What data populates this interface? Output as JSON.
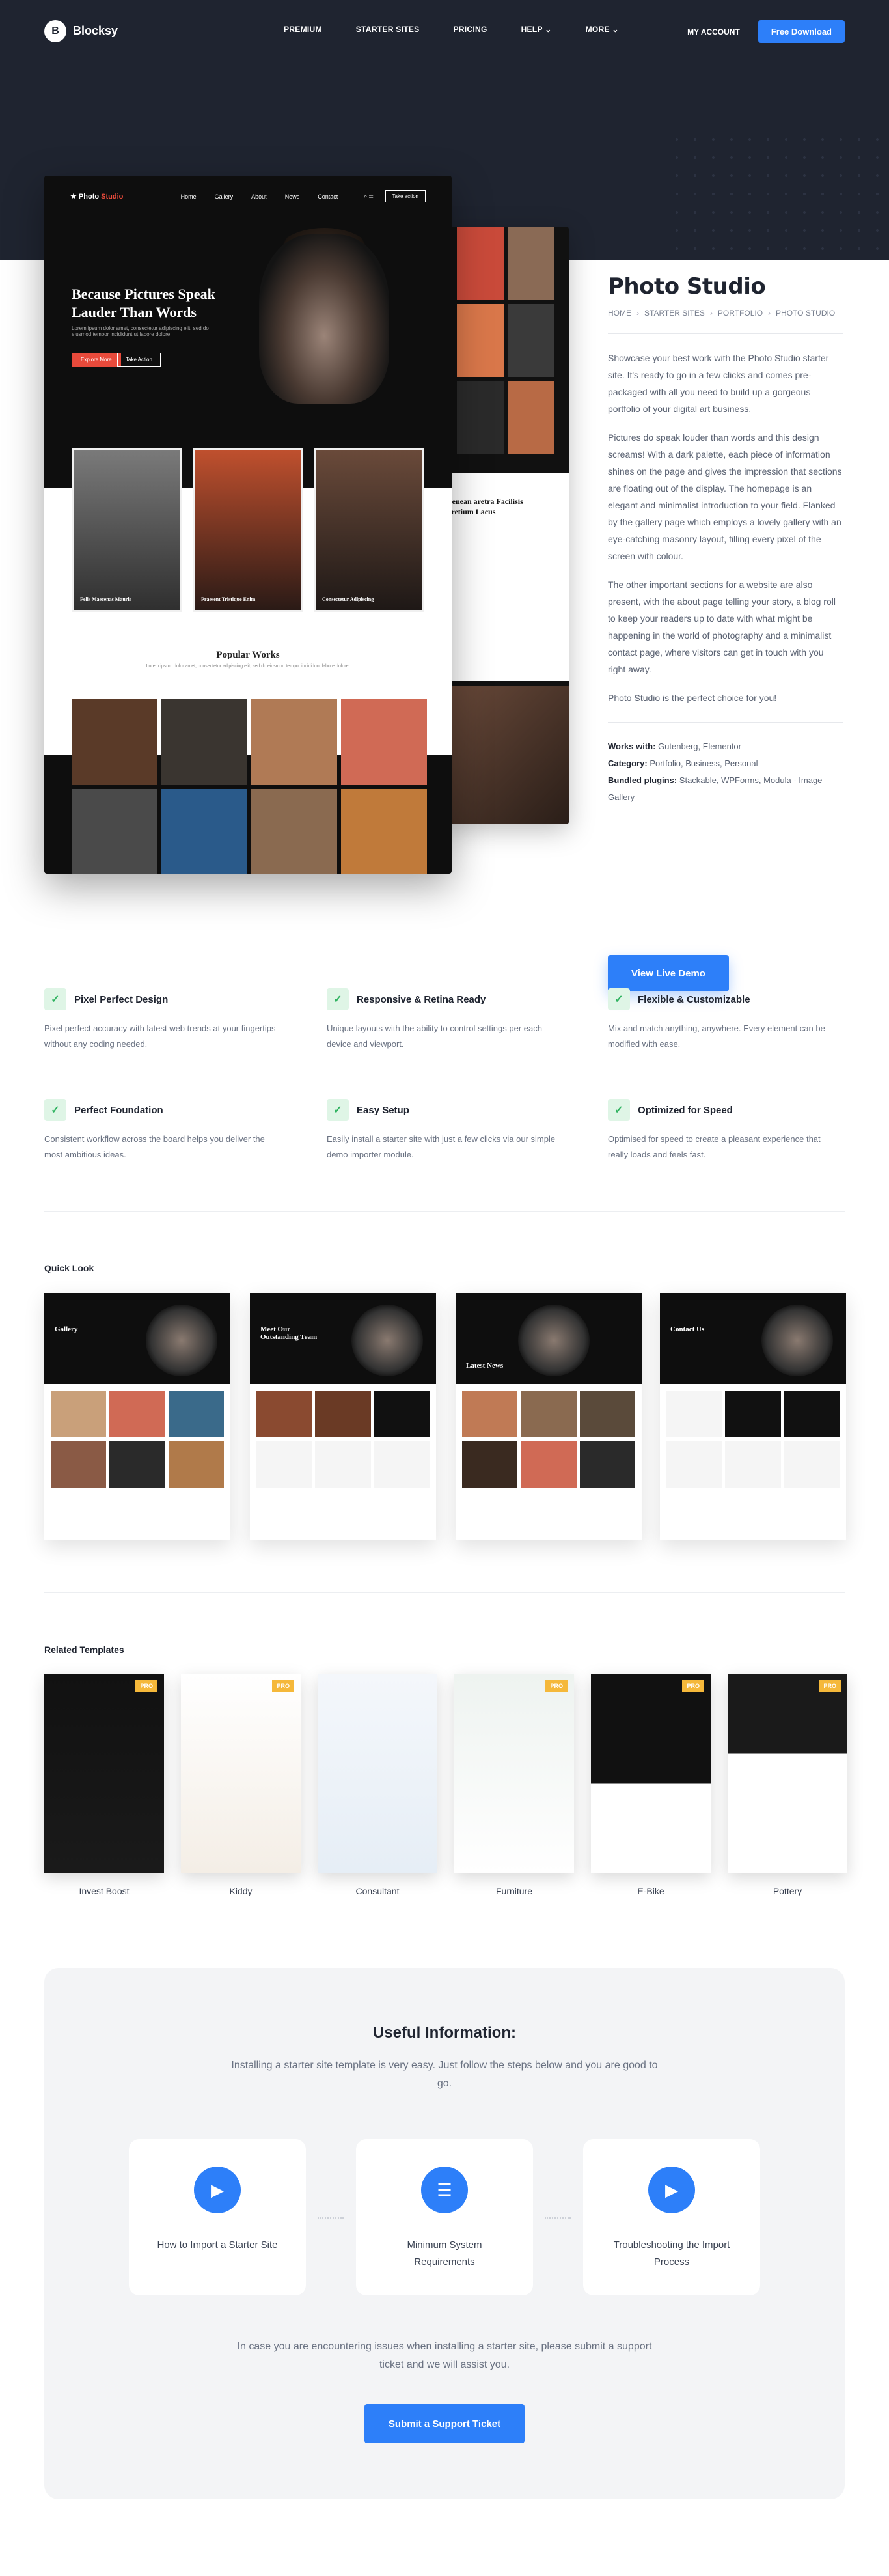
{
  "header": {
    "logo": "Blocksy",
    "logo_mark": "B",
    "nav": [
      "PREMIUM",
      "STARTER SITES",
      "PRICING",
      "HELP",
      "MORE"
    ],
    "account": "MY ACCOUNT",
    "download": "Free Download"
  },
  "mockup": {
    "brand_a": "Photo",
    "brand_b": "Studio",
    "nav_links": [
      "Home",
      "Gallery",
      "About",
      "News",
      "Contact"
    ],
    "nav_button": "Take action",
    "hero_title": "Because Pictures Speak Lauder Than Words",
    "hero_sub": "Lorem ipsum dolor amet, consectetur adipiscing elit, sed do eiusmod tempor incididunt ut labore dolore.",
    "hero_btn1": "Explore More",
    "hero_btn2": "Take Action",
    "cards": [
      "Felis Maecenas Mauris",
      "Praesent Tristique Enim",
      "Consectetur Adipiscing"
    ],
    "popular_title": "Popular Works",
    "popular_sub": "Lorem ipsum dolor amet, consectetur adipiscing elit, sed do eiusmod tempor incididunt labore dolore.",
    "back_title": "Aenean aretra Facilisis Pretium Lacus"
  },
  "sidebar": {
    "title": "Photo Studio",
    "breadcrumb": [
      "HOME",
      "STARTER SITES",
      "PORTFOLIO",
      "PHOTO STUDIO"
    ],
    "paragraphs": [
      "Showcase your best work with the Photo Studio starter site. It's ready to go in a few clicks and comes pre-packaged with all you need to build up a gorgeous portfolio of your digital art business.",
      "Pictures do speak louder than words and this design screams! With a dark palette, each piece of information shines on the page and gives the impression that sections are floating out of the display. The homepage is an elegant and minimalist introduction to your field. Flanked by the gallery page which employs a lovely gallery with an eye-catching masonry layout, filling every pixel of the screen with colour.",
      "The other important sections for a website are also present, with the about page telling your story, a blog roll to keep your readers up to date with what might be happening in the world of photography and a minimalist contact page, where visitors can get in touch with you right away.",
      "Photo Studio is the perfect choice for you!"
    ],
    "works_with_label": "Works with:",
    "works_with": "Gutenberg, Elementor",
    "category_label": "Category:",
    "category": "Portfolio, Business, Personal",
    "plugins_label": "Bundled plugins:",
    "plugins": "Stackable, WPForms, Modula - Image Gallery",
    "live_demo": "View Live Demo"
  },
  "features": [
    {
      "title": "Pixel Perfect Design",
      "text": "Pixel perfect accuracy with latest web trends at your fingertips without any coding needed."
    },
    {
      "title": "Responsive & Retina Ready",
      "text": "Unique layouts with the ability to control settings per each device and viewport."
    },
    {
      "title": "Flexible & Customizable",
      "text": "Mix and match anything, anywhere. Every element can be modified with ease."
    },
    {
      "title": "Perfect Foundation",
      "text": "Consistent workflow across the board helps you deliver the most ambitious ideas."
    },
    {
      "title": "Easy Setup",
      "text": "Easily install a starter site with just a few clicks via our simple demo importer module."
    },
    {
      "title": "Optimized for Speed",
      "text": "Optimised for speed to create a pleasant experience that really loads and feels fast."
    }
  ],
  "quick_look": {
    "title": "Quick Look",
    "pages": [
      "Gallery",
      "Meet Our Outstanding Team",
      "Latest News",
      "Contact Us"
    ]
  },
  "related": {
    "title": "Related Templates",
    "pro_badge": "PRO",
    "items": [
      "Invest Boost",
      "Kiddy",
      "Consultant",
      "Furniture",
      "E-Bike",
      "Pottery"
    ]
  },
  "info": {
    "title": "Useful Information:",
    "subtitle": "Installing a starter site template is very easy. Just follow the steps below and you are good to go.",
    "cards": [
      "How to Import a Starter Site",
      "Minimum System Requirements",
      "Troubleshooting the Import Process"
    ],
    "note": "In case you are encountering issues when installing a starter site, please submit a support ticket and we will assist you.",
    "ticket": "Submit a Support Ticket"
  },
  "colors": {
    "accent": "#2d7ff9",
    "dark": "#1f2430",
    "check_bg": "#dff5e6",
    "check": "#2fb360",
    "pro": "#f5b83a",
    "mock_red": "#e84a3b"
  }
}
